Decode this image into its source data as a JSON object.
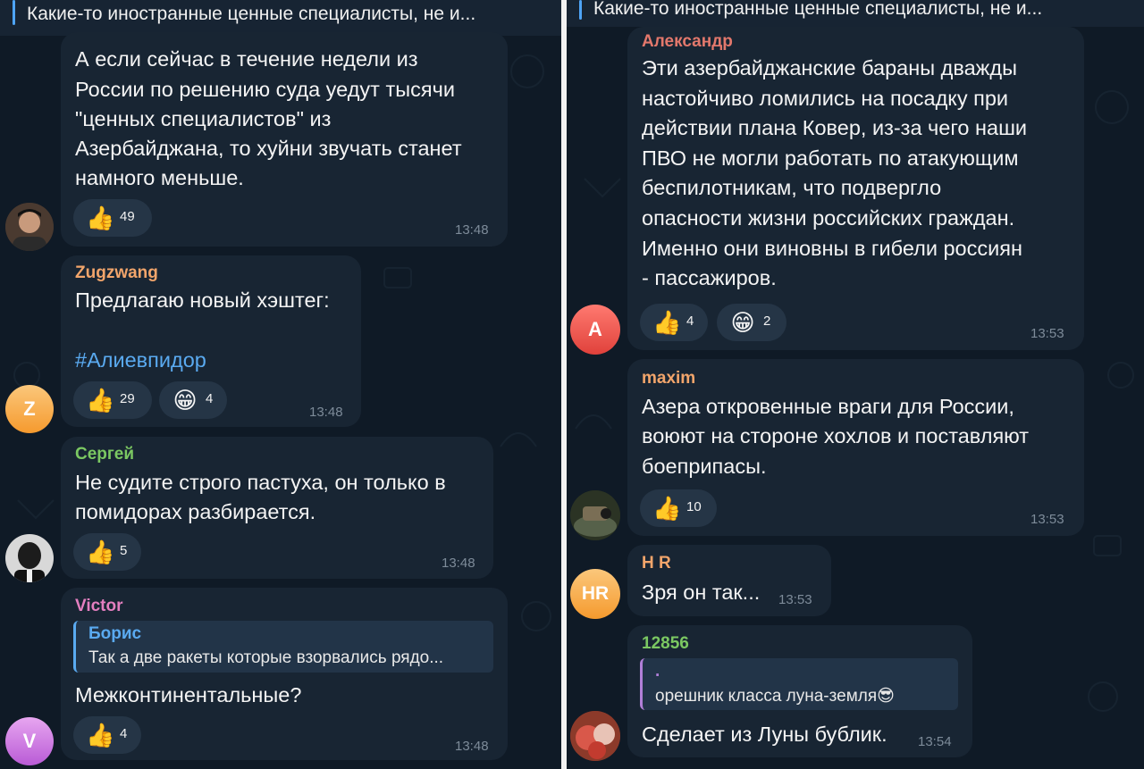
{
  "left": {
    "pinned_text": "Какие-то иностранные ценные специалисты, не и...",
    "msg1": {
      "lines": [
        "А если сейчас в течение недели из",
        "России по решению суда уедут тысячи",
        "\"ценных специалистов\" из",
        "Азербайджана, то хуйни звучать станет",
        "намного меньше."
      ],
      "reactions": [
        {
          "icon": "thumbs-up",
          "count": "49"
        }
      ],
      "time": "13:48"
    },
    "msg2": {
      "author": "Zugzwang",
      "line1": "Предлагаю новый хэштег:",
      "hashtag": "#Алиевпидор",
      "reactions": [
        {
          "icon": "thumbs-up",
          "count": "29"
        },
        {
          "icon": "grin",
          "count": "4"
        }
      ],
      "time": "13:48",
      "avatar_letter": "Z"
    },
    "msg3": {
      "author": "Сергей",
      "lines": [
        "Не судите строго пастуха, он только в",
        "помидорах разбирается."
      ],
      "reactions": [
        {
          "icon": "thumbs-up",
          "count": "5"
        }
      ],
      "time": "13:48"
    },
    "msg4": {
      "author": "Victor",
      "reply_author": "Борис",
      "reply_text": "Так а две ракеты которые взорвались рядо...",
      "text": "Межконтинентальные?",
      "reactions": [
        {
          "icon": "thumbs-up",
          "count": "4"
        }
      ],
      "time": "13:48",
      "avatar_letter": "V"
    }
  },
  "right": {
    "pinned_text": "Какие-то иностранные ценные специалисты, не и...",
    "msg1": {
      "author": "Александр",
      "lines": [
        "Эти азербайджанские бараны дважды",
        "настойчиво ломились на посадку при",
        "действии плана Ковер, из-за чего наши",
        "ПВО не могли работать  по атакующим",
        "беспилотникам, что подвергло",
        "опасности жизни российских граждан.",
        "Именно они виновны в гибели россиян",
        "- пассажиров."
      ],
      "reactions": [
        {
          "icon": "thumbs-up",
          "count": "4"
        },
        {
          "icon": "grin",
          "count": "2"
        }
      ],
      "time": "13:53",
      "avatar_letter": "А"
    },
    "msg2": {
      "author": "maxim",
      "lines": [
        "Азера откровенные враги для России,",
        "воюют на стороне хохлов и поставляют",
        "боеприпасы."
      ],
      "reactions": [
        {
          "icon": "thumbs-up",
          "count": "10"
        }
      ],
      "time": "13:53"
    },
    "msg3": {
      "author": "H R",
      "text": "Зря он так...",
      "time": "13:53",
      "avatar_letters": "HR"
    },
    "msg4": {
      "author": "12856",
      "reply_author": ".",
      "reply_text": "орешник класса луна-земля😎",
      "text": "Сделает из Луны бублик.",
      "time": "13:54"
    }
  },
  "colors": {
    "background": "#0f1a26",
    "bubble": "#182533",
    "name_orange": "#f2a56b",
    "name_green": "#7bc862",
    "name_pink": "#e47fc0",
    "name_red": "#e3786c",
    "link": "#5aaaf0"
  }
}
